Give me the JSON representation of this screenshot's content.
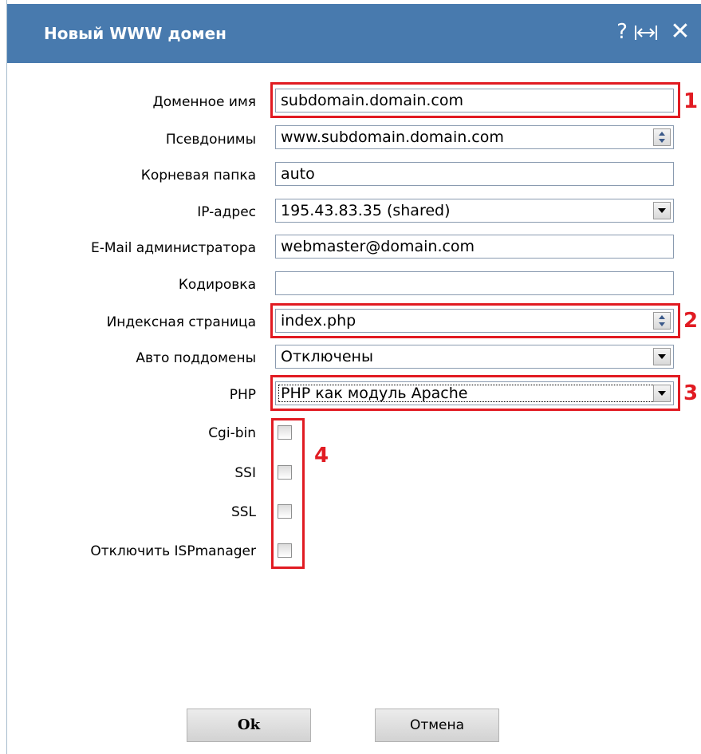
{
  "dialog": {
    "title": "Новый WWW домен",
    "icons": {
      "help": "?",
      "resize": "⟷",
      "close": "✕"
    }
  },
  "form": {
    "domain": {
      "label": "Доменное имя",
      "value": "subdomain.domain.com"
    },
    "aliases": {
      "label": "Псевдонимы",
      "value": "www.subdomain.domain.com"
    },
    "root": {
      "label": "Корневая папка",
      "value": "auto"
    },
    "ip": {
      "label": "IP-адрес",
      "value": "195.43.83.35 (shared)"
    },
    "email": {
      "label": "E-Mail администратора",
      "value": "webmaster@domain.com"
    },
    "charset": {
      "label": "Кодировка",
      "value": ""
    },
    "index": {
      "label": "Индексная страница",
      "value": "index.php"
    },
    "autosub": {
      "label": "Авто поддомены",
      "value": "Отключены"
    },
    "php": {
      "label": "PHP",
      "value": "PHP как модуль Apache"
    },
    "cgi": {
      "label": "Cgi-bin",
      "checked": false
    },
    "ssi": {
      "label": "SSI",
      "checked": false
    },
    "ssl": {
      "label": "SSL",
      "checked": false
    },
    "disable_isp": {
      "label": "Отключить ISPmanager",
      "checked": false
    }
  },
  "annotations": {
    "n1": "1",
    "n2": "2",
    "n3": "3",
    "n4": "4",
    "color": "#e11b22"
  },
  "buttons": {
    "ok": "Ok",
    "cancel": "Отмена"
  },
  "colors": {
    "titlebar": "#487aae"
  }
}
